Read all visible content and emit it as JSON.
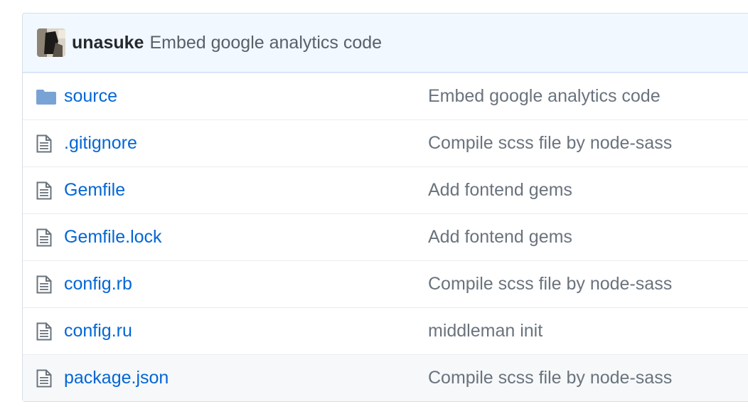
{
  "commit": {
    "author": "unasuke",
    "message": "Embed google analytics code",
    "avatar_icon": "user-avatar"
  },
  "colors": {
    "link": "#0366d6",
    "muted": "#6a737d",
    "header_bg": "#f1f8ff",
    "folder": "#79b8ff"
  },
  "files": [
    {
      "name": "source",
      "type": "directory",
      "icon": "folder-icon",
      "message": "Embed google analytics code"
    },
    {
      "name": ".gitignore",
      "type": "file",
      "icon": "file-icon",
      "message": "Compile scss file by node-sass"
    },
    {
      "name": "Gemfile",
      "type": "file",
      "icon": "file-icon",
      "message": "Add fontend gems"
    },
    {
      "name": "Gemfile.lock",
      "type": "file",
      "icon": "file-icon",
      "message": "Add fontend gems"
    },
    {
      "name": "config.rb",
      "type": "file",
      "icon": "file-icon",
      "message": "Compile scss file by node-sass"
    },
    {
      "name": "config.ru",
      "type": "file",
      "icon": "file-icon",
      "message": "middleman init"
    },
    {
      "name": "package.json",
      "type": "file",
      "icon": "file-icon",
      "message": "Compile scss file by node-sass"
    }
  ]
}
